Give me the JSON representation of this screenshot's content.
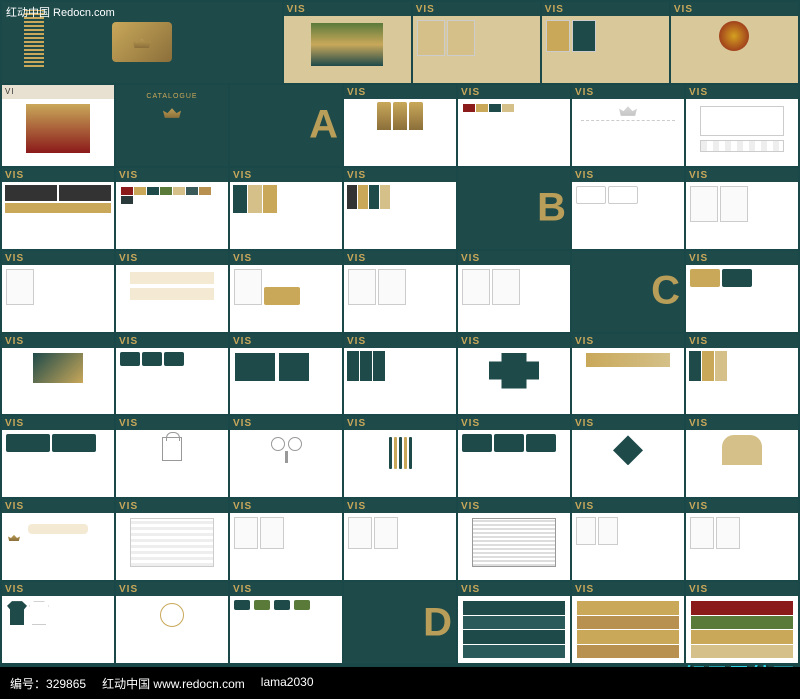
{
  "watermarks": {
    "top_left": "红动中国 Redocn.com",
    "bottom_right_small": "红动中国 redocn.com",
    "brand": "姐己导航网"
  },
  "info_bar": {
    "id_label": "编号：",
    "id_value": "329865",
    "site_label": "红动中国",
    "site_url": "www.redocn.com",
    "author": "lama2030"
  },
  "vis_label": "VIS",
  "section_letters": {
    "a": "A",
    "b": "B",
    "c": "C",
    "d": "D"
  },
  "catalogue_title": "CATALOGUE"
}
